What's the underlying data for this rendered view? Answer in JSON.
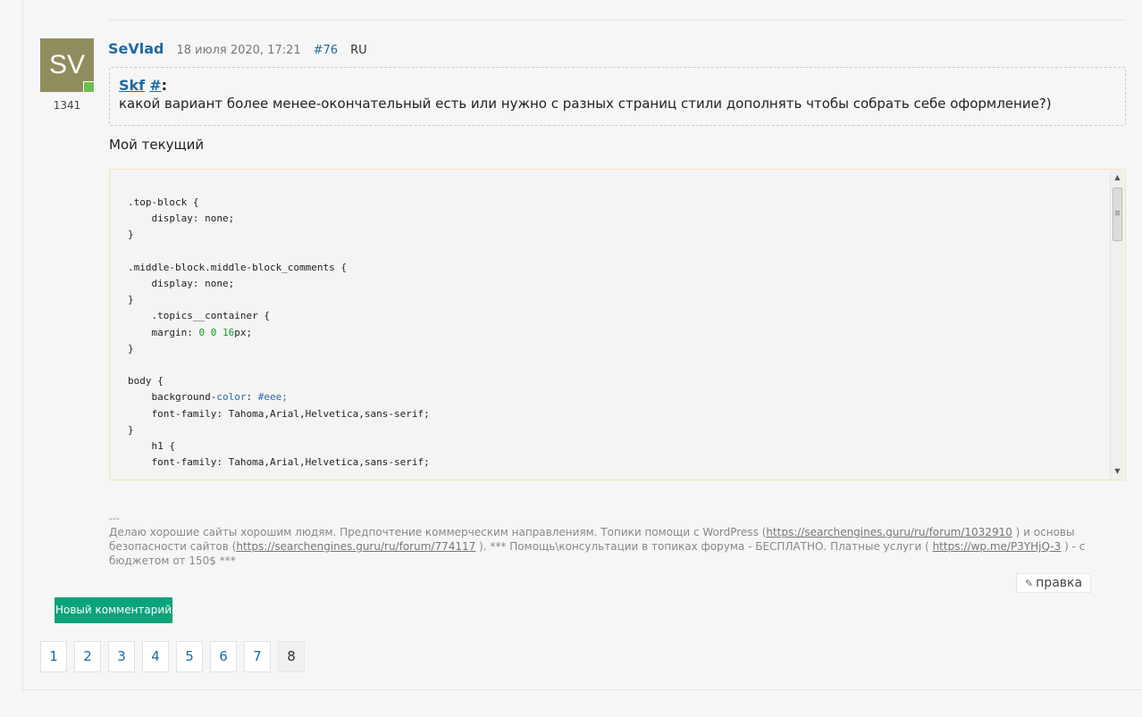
{
  "post": {
    "avatar_initials": "SV",
    "post_count": "1341",
    "author": "SeVlad",
    "date": "18 июля 2020, 17:21",
    "permalink": "#76",
    "lang": "RU",
    "quote": {
      "author": "Skf",
      "hash": "#",
      "colon": ":",
      "text": "какой вариант более менее-окончательный есть или нужно с разных страниц стили дополнять чтобы собрать себе оформление?)"
    },
    "intro": "Мой текущий",
    "code_lines": [
      ".top-block {",
      "    display: none;",
      "}",
      "",
      ".middle-block.middle-block_comments {",
      "    display: none;",
      "}",
      "    .topics__container {",
      "    margin: 0 0 16px;",
      "}",
      "",
      "body {",
      "    background-color: #eee;",
      "    font-family: Tahoma,Arial,Helvetica,sans-serif;",
      "}",
      "    h1 {",
      "    font-family: Tahoma,Arial,Helvetica,sans-serif;"
    ],
    "signature": {
      "separator": "---",
      "text_1": "Делаю хорошие сайты хорошим людям. Предпочтение коммерческим направлениям. Топики помощи с WordPress (",
      "link_1": "https://searchengines.guru/ru/forum/1032910",
      "text_2": " ) и основы безопасности сайтов (",
      "link_2": "https://searchengines.guru/ru/forum/774117",
      "text_3": " ). *** Помощь\\консультации в топиках форума - БЕСПЛАТНО. Платные услуги ( ",
      "link_3": "https://wp.me/P3YHjQ-3",
      "text_4": " ) - с бюджетом от 150$ ***"
    },
    "edit_label": "правка"
  },
  "new_comment_label": "Новый комментарий",
  "pagination": {
    "pages": [
      "1",
      "2",
      "3",
      "4",
      "5",
      "6",
      "7",
      "8"
    ],
    "current": "8"
  },
  "icons": {
    "pencil": "pencil-icon",
    "scroll_up": "scroll-up-icon",
    "scroll_down": "scroll-down-icon"
  },
  "colors": {
    "link": "#1e6aa5",
    "avatar_bg": "#8f8d5d",
    "online": "#6cc24a",
    "new_comment_bg": "#0ba37a"
  }
}
